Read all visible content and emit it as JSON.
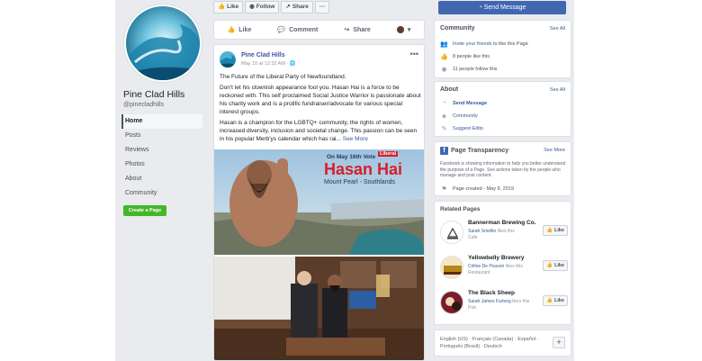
{
  "page": {
    "name": "Pine Clad Hills",
    "handle": "@pinecladhills",
    "create_page_label": "Create a Page"
  },
  "nav": [
    "Home",
    "Posts",
    "Reviews",
    "Photos",
    "About",
    "Community"
  ],
  "toolbar": {
    "like": "Like",
    "follow": "Follow",
    "share": "Share",
    "more": "···",
    "send_message": "Send Message"
  },
  "actionbar": {
    "like": "Like",
    "comment": "Comment",
    "share": "Share"
  },
  "post": {
    "author": "Pine Clad Hills",
    "date": "May 10 at 12:32 AM · ",
    "line1": "The Future of the Liberal Party of Newfoundland.",
    "para1": "Don't let his clownish appearance fool you. Hasan Hai is a force to be reckoned with. This self proclaimed Social Justice Warrior is passionate about his charity work and is a prolific fundraiser/advocate for various special interest groups.",
    "para2": "Hasan is a champion for the LGBTQ+ community, the rights of women, increased diversity, inclusion and societal change. This passion can be seen in his popular Merb'ys calendar which has rai... ",
    "see_more": "See More",
    "poster": {
      "vote": "On May 16th Vote",
      "party": "Liberal",
      "candidate": "Hasan Hai",
      "district": "Mount Pearl - Southlands"
    }
  },
  "community": {
    "title": "Community",
    "see_all": "See All",
    "invite_link": "Invite your friends",
    "invite_rest": " to like this Page",
    "likes": "8 people like this",
    "follows": "11 people follow this"
  },
  "about": {
    "title": "About",
    "see_all": "See All",
    "send_message": "Send Message",
    "community": "Community",
    "suggest_edits": "Suggest Edits"
  },
  "transparency": {
    "title": "Page Transparency",
    "see_more": "See More",
    "description": "Facebook is showing information to help you better understand the purpose of a Page. See actions taken by the people who manage and post content.",
    "created": "Page created - May 9, 2019"
  },
  "related": {
    "title": "Related Pages",
    "like_label": "Like",
    "items": [
      {
        "name": "Bannerman Brewing Co.",
        "friend": "Sarah Smellie",
        "rest": " likes this",
        "category": "Cafe"
      },
      {
        "name": "Yellowbelly Brewery",
        "friend": "Céline De Pouvoir",
        "rest": " likes this",
        "category": "Restaurant"
      },
      {
        "name": "The Black Sheep",
        "friend": "Sarah James Furlong",
        "rest": " likes this",
        "category": "Pub"
      }
    ]
  },
  "languages": {
    "text": "English (US) · Français (Canada) · Español · Português (Brasil) · Deutsch",
    "add": "+"
  },
  "colors": {
    "brand_blue": "#4267b2",
    "link_blue": "#385898",
    "create_green": "#42b72a",
    "page_bg": "#e9ebee"
  }
}
